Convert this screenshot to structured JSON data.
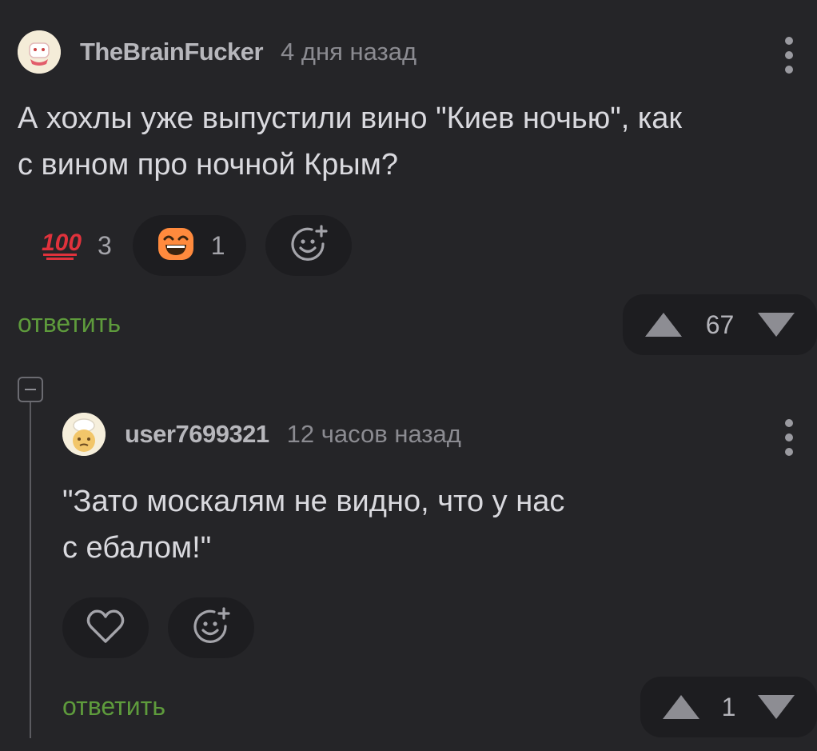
{
  "comment": {
    "author": "TheBrainFucker",
    "time": "4 дня назад",
    "text_line1": "А хохлы уже выпустили вино \"Киев ночью\", как",
    "text_line2": "с вином про ночной Крым?",
    "reactions": [
      {
        "icon": "hundred-points-icon",
        "count": "3"
      },
      {
        "icon": "grinning-face-icon",
        "count": "1"
      }
    ],
    "reply_label": "ответить",
    "score": "67"
  },
  "reply": {
    "author": "user7699321",
    "time": "12 часов назад",
    "text_line1": "\"Зато москалям не видно, что у нас",
    "text_line2": "с ебалом!\"",
    "reply_label": "ответить",
    "score": "1"
  },
  "colors": {
    "background": "#252528",
    "pill": "#1d1d20",
    "reply_link": "#5e9b3c",
    "icon_gray": "#8d8d93"
  }
}
